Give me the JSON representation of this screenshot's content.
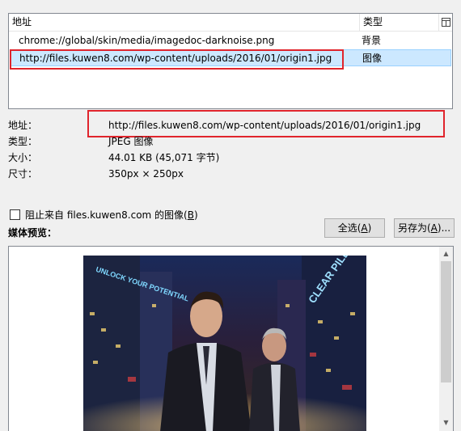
{
  "media_list": {
    "col_address": "地址",
    "col_type": "类型",
    "column_picker_icon": "column-picker-icon",
    "rows": [
      {
        "address": "chrome://global/skin/media/imagedoc-darknoise.png",
        "type": "背景"
      },
      {
        "address": "http://files.kuwen8.com/wp-content/uploads/2016/01/origin1.jpg",
        "type": "图像"
      }
    ]
  },
  "properties": {
    "address_label": "地址：",
    "address_value": "http://files.kuwen8.com/wp-content/uploads/2016/01/origin1.jpg",
    "type_label": "类型：",
    "type_value": "JPEG 图像",
    "size_label": "大小：",
    "size_value": "44.01 KB (45,071 字节)",
    "dimensions_label": "尺寸：",
    "dimensions_value": "350px × 250px"
  },
  "block_images": {
    "label_prefix": "阻止来自 files.kuwen8.com 的图像(",
    "accesskey": "B",
    "label_suffix": ")",
    "checked": false
  },
  "buttons": {
    "select_all_prefix": "全选(",
    "select_all_key": "A",
    "select_all_suffix": ")",
    "save_as_prefix": "另存为(",
    "save_as_key": "A",
    "save_as_suffix": ")..."
  },
  "preview": {
    "label": "媒体预览：",
    "sign_left": "UNLOCK YOUR POTENTIAL",
    "sign_right": "CLEAR PILL"
  },
  "colors": {
    "selection_bg": "#cce8ff",
    "highlight_red": "#e0242c"
  }
}
